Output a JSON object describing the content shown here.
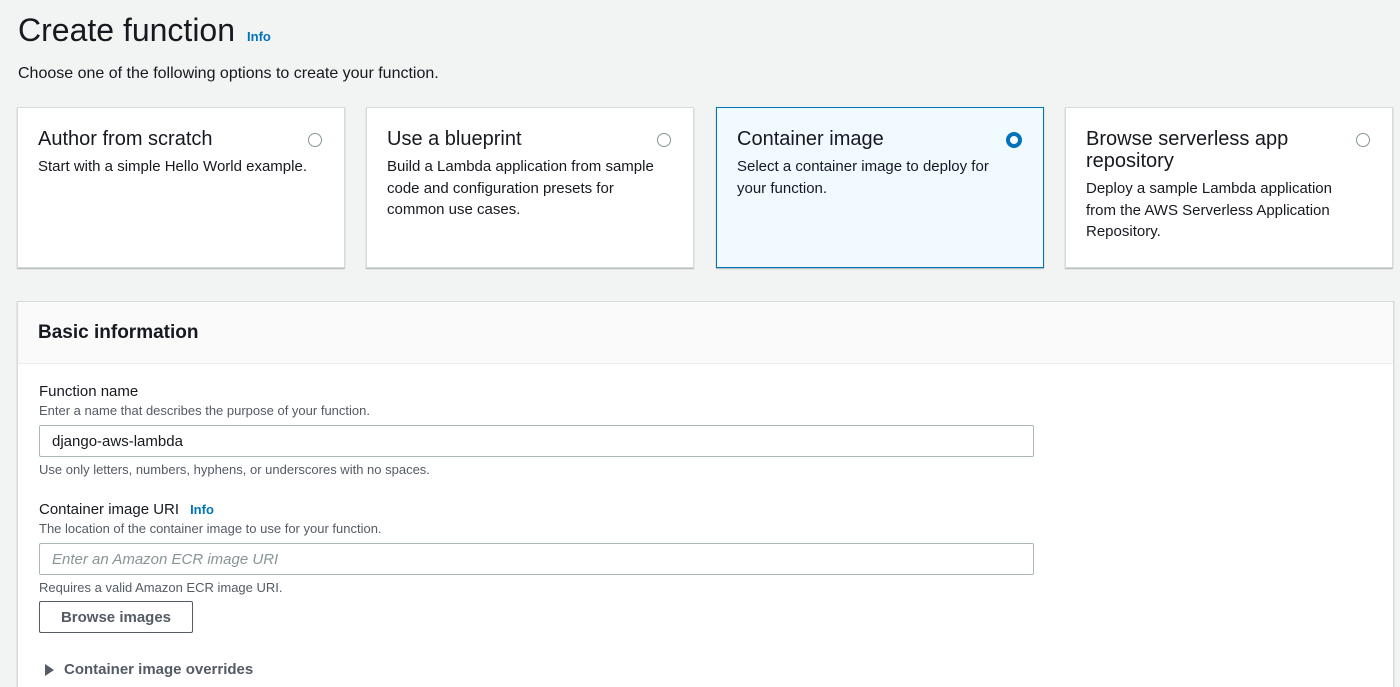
{
  "page": {
    "title": "Create function",
    "info_label": "Info",
    "subtitle": "Choose one of the following options to create your function."
  },
  "options": [
    {
      "title": "Author from scratch",
      "description": "Start with a simple Hello World example.",
      "selected": false
    },
    {
      "title": "Use a blueprint",
      "description": "Build a Lambda application from sample code and configuration presets for common use cases.",
      "selected": false
    },
    {
      "title": "Container image",
      "description": "Select a container image to deploy for your function.",
      "selected": true
    },
    {
      "title": "Browse serverless app repository",
      "description": "Deploy a sample Lambda application from the AWS Serverless Application Repository.",
      "selected": false
    }
  ],
  "basic_info": {
    "title": "Basic information",
    "function_name": {
      "label": "Function name",
      "description": "Enter a name that describes the purpose of your function.",
      "value": "django-aws-lambda",
      "hint": "Use only letters, numbers, hyphens, or underscores with no spaces."
    },
    "image_uri": {
      "label": "Container image URI",
      "info_label": "Info",
      "description": "The location of the container image to use for your function.",
      "value": "",
      "placeholder": "Enter an Amazon ECR image URI",
      "hint": "Requires a valid Amazon ECR image URI."
    },
    "browse_button_label": "Browse images",
    "overrides_label": "Container image overrides"
  },
  "colors": {
    "accent": "#0073bb",
    "background": "#f2f3f3",
    "selected_card_bg": "#f1faff",
    "text": "#16191f",
    "secondary_text": "#545b64"
  }
}
